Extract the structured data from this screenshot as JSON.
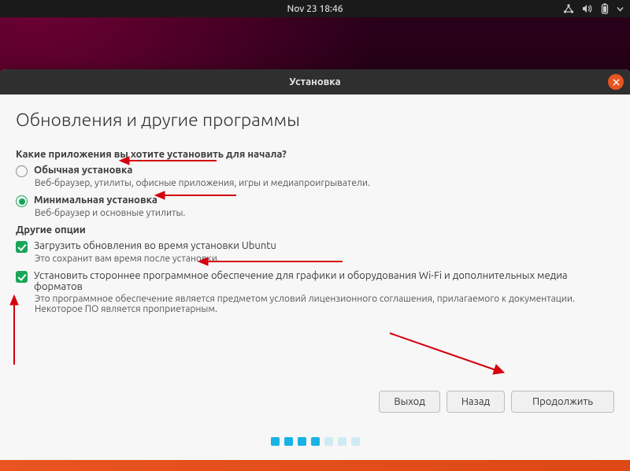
{
  "topbar": {
    "datetime": "Nov 23  18:46"
  },
  "window": {
    "title": "Установка",
    "heading": "Обновления и другие программы",
    "q1": "Какие приложения вы хотите установить для начала?",
    "normal": {
      "label": "Обычная установка",
      "desc": "Веб-браузер, утилиты, офисные приложения, игры и медиапроигрыватели."
    },
    "minimal": {
      "label": "Минимальная установка",
      "desc": "Веб-браузер и основные утилиты."
    },
    "other_heading": "Другие опции",
    "updates": {
      "label": "Загрузить обновления во время установки Ubuntu",
      "desc": "Это сохранит вам время после установки."
    },
    "thirdparty": {
      "label": "Установить стороннее программное обеспечение для графики и оборудования Wi-Fi и дополнительных медиа форматов",
      "desc": "Это программное обеспечение является предметом условий лицензионного соглашения, прилагаемого к документации. Некоторое ПО является проприетарным."
    },
    "buttons": {
      "quit": "Выход",
      "back": "Назад",
      "continue": "Продолжить"
    }
  }
}
